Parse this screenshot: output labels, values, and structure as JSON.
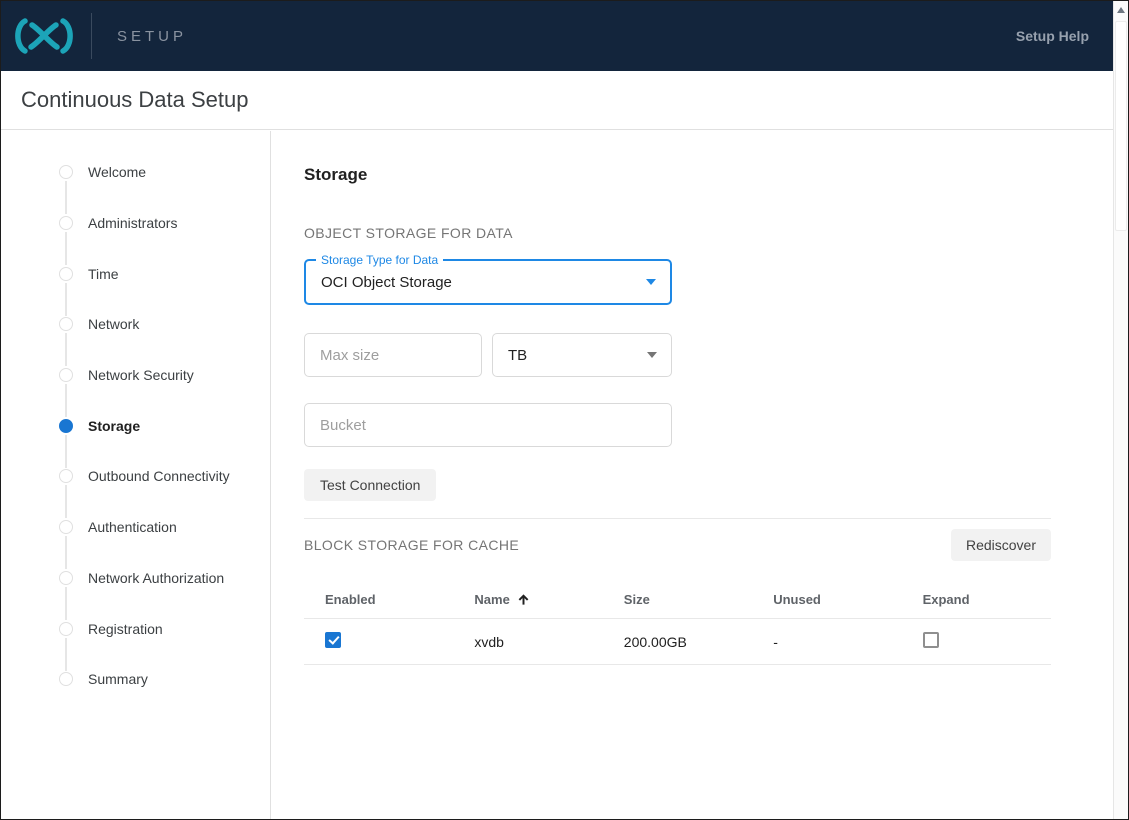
{
  "navbar": {
    "logo_name": "delphix-logo",
    "product_label": "SETUP",
    "help_label": "Setup Help"
  },
  "page": {
    "title": "Continuous Data Setup"
  },
  "stepper": {
    "items": [
      {
        "label": "Welcome",
        "active": false
      },
      {
        "label": "Administrators",
        "active": false
      },
      {
        "label": "Time",
        "active": false
      },
      {
        "label": "Network",
        "active": false
      },
      {
        "label": "Network Security",
        "active": false
      },
      {
        "label": "Storage",
        "active": true
      },
      {
        "label": "Outbound Connectivity",
        "active": false
      },
      {
        "label": "Authentication",
        "active": false
      },
      {
        "label": "Network Authorization",
        "active": false
      },
      {
        "label": "Registration",
        "active": false
      },
      {
        "label": "Summary",
        "active": false
      }
    ]
  },
  "main": {
    "heading": "Storage",
    "object_storage": {
      "section_title": "OBJECT STORAGE FOR DATA",
      "storage_type": {
        "label": "Storage Type for Data",
        "value": "OCI Object Storage"
      },
      "max_size": {
        "placeholder": "Max size",
        "value": ""
      },
      "unit": {
        "value": "TB"
      },
      "bucket": {
        "placeholder": "Bucket",
        "value": ""
      },
      "test_connection_label": "Test Connection"
    },
    "block_storage": {
      "section_title": "BLOCK STORAGE FOR CACHE",
      "rediscover_label": "Rediscover",
      "table": {
        "columns": [
          "Enabled",
          "Name",
          "Size",
          "Unused",
          "Expand"
        ],
        "sort_column": "Name",
        "sort_direction": "ascending",
        "rows": [
          {
            "enabled": true,
            "name": "xvdb",
            "size": "200.00GB",
            "unused": "-",
            "expand": false
          }
        ]
      }
    }
  },
  "colors": {
    "navbar_background": "#13253c",
    "brand_teal": "#1ca4b8",
    "accent_blue": "#1976d2",
    "focused_field_blue": "#1e88e5"
  }
}
